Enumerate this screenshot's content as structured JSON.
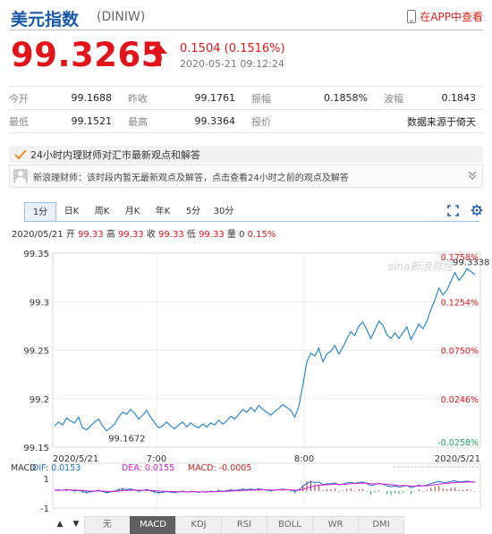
{
  "header": {
    "title": "美元指数",
    "code": "(DINIW)",
    "app_link": "在APP中查看"
  },
  "quote": {
    "price": "99.3265",
    "change": "0.1504 (0.1516%)",
    "timestamp": "2020-05-21 09:12:24"
  },
  "stats": {
    "rows": [
      [
        {
          "label": "今开",
          "value": "99.1688"
        },
        {
          "label": "昨收",
          "value": "99.1761"
        },
        {
          "label": "振幅",
          "value": "0.1858%"
        },
        {
          "label": "波幅",
          "value": "0.1843"
        }
      ],
      [
        {
          "label": "最低",
          "value": "99.1521"
        },
        {
          "label": "最高",
          "value": "99.3364"
        },
        {
          "label": "报价",
          "value": ""
        },
        {
          "label": "",
          "value": "数据来源于倚天"
        }
      ]
    ]
  },
  "notice": {
    "title": "24小时内理财师对汇市最新观点和解答",
    "advisor_text": "新浪理财师：该时段内暂无最新观点及解答，点击查看24小时之前的观点及解答"
  },
  "chart_tabs": [
    "1分",
    "日K",
    "周K",
    "月K",
    "年K",
    "5分",
    "30分"
  ],
  "chart_tabs_active": 0,
  "ohlc_line": {
    "date": "2020/05/21",
    "open_label": "开",
    "open": "99.33",
    "high_label": "高",
    "high": "99.33",
    "close_label": "收",
    "close": "99.33",
    "low_label": "低",
    "low": "99.33",
    "vol_label": "量",
    "vol": "0",
    "pct": "0.15%"
  },
  "chart_data": [
    {
      "type": "line",
      "x_ticks": [
        "2020/5/21",
        "7:00",
        "8:00",
        "2020/5/21"
      ],
      "y_ticks": [
        "99.35",
        "99.3",
        "99.25",
        "99.2",
        "99.15"
      ],
      "y_right_ticks": [
        "0.1758%",
        "0.1254%",
        "0.0750%",
        "0.0246%",
        "-0.0258%"
      ],
      "ylim": [
        99.15,
        99.35
      ],
      "annotations": {
        "low": "99.1672",
        "high": "99.3338"
      },
      "watermark": "sina新浪财经",
      "series": [
        {
          "values": [
            99.172,
            99.176,
            99.173,
            99.18,
            99.177,
            99.175,
            99.181,
            99.17,
            99.168,
            99.172,
            99.176,
            99.179,
            99.172,
            99.167,
            99.17,
            99.174,
            99.181,
            99.186,
            99.184,
            99.189,
            99.185,
            99.179,
            99.183,
            99.188,
            99.181,
            99.175,
            99.17,
            99.172,
            99.176,
            99.172,
            99.169,
            99.173,
            99.176,
            99.171,
            99.175,
            99.172,
            99.17,
            99.174,
            99.171,
            99.175,
            99.173,
            99.178,
            99.174,
            99.177,
            99.182,
            99.179,
            99.184,
            99.189,
            99.186,
            99.191,
            99.187,
            99.193,
            99.189,
            99.186,
            99.183,
            99.187,
            99.19,
            99.194,
            99.191,
            99.188,
            99.181,
            99.192,
            99.214,
            99.238,
            99.247,
            99.244,
            99.252,
            99.238,
            99.246,
            99.249,
            99.255,
            99.246,
            99.253,
            99.262,
            99.269,
            99.265,
            99.275,
            99.279,
            99.271,
            99.262,
            99.271,
            99.28,
            99.276,
            99.266,
            99.262,
            99.268,
            99.262,
            99.268,
            99.274,
            99.261,
            99.269,
            99.277,
            99.272,
            99.28,
            99.292,
            99.302,
            99.314,
            99.307,
            99.312,
            99.321,
            99.33,
            99.322,
            99.327,
            99.334,
            99.331,
            99.328
          ]
        }
      ]
    },
    {
      "type": "bar",
      "title": "MACD",
      "legend": [
        {
          "name": "DIF: 0.0153",
          "color": "#1a6fc7"
        },
        {
          "name": "DEA: 0.0155",
          "color": "#d21bd2"
        },
        {
          "name": "MACD: -0.0005",
          "color": "#d4211c"
        }
      ],
      "y_ticks": [
        "1",
        "-1"
      ],
      "ylim": [
        -1.2,
        1.2
      ],
      "dif": [
        0.05,
        0.08,
        0.05,
        0.1,
        0.06,
        0.02,
        0.05,
        -0.03,
        -0.08,
        -0.05,
        0.0,
        0.05,
        -0.03,
        -0.1,
        -0.05,
        0.0,
        0.08,
        0.14,
        0.1,
        0.14,
        0.08,
        0.0,
        0.05,
        0.1,
        0.03,
        -0.05,
        -0.1,
        -0.08,
        -0.03,
        -0.07,
        -0.1,
        -0.06,
        -0.02,
        -0.07,
        -0.03,
        -0.05,
        -0.08,
        -0.04,
        -0.07,
        -0.02,
        -0.04,
        0.02,
        -0.02,
        0.02,
        0.07,
        0.04,
        0.08,
        0.12,
        0.09,
        0.13,
        0.09,
        0.14,
        0.1,
        0.06,
        0.03,
        0.06,
        0.09,
        0.12,
        0.09,
        0.06,
        -0.02,
        0.08,
        0.3,
        0.5,
        0.6,
        0.55,
        0.58,
        0.42,
        0.46,
        0.48,
        0.52,
        0.4,
        0.45,
        0.52,
        0.56,
        0.5,
        0.56,
        0.58,
        0.48,
        0.36,
        0.42,
        0.5,
        0.45,
        0.34,
        0.28,
        0.32,
        0.26,
        0.3,
        0.36,
        0.22,
        0.3,
        0.38,
        0.32,
        0.38,
        0.48,
        0.55,
        0.62,
        0.55,
        0.56,
        0.62,
        0.66,
        0.58,
        0.6,
        0.64,
        0.6,
        0.56
      ],
      "dea": [
        0.05,
        0.06,
        0.06,
        0.07,
        0.07,
        0.06,
        0.06,
        0.04,
        0.02,
        0.0,
        0.0,
        0.01,
        0.0,
        -0.02,
        -0.03,
        -0.02,
        0.0,
        0.03,
        0.04,
        0.06,
        0.07,
        0.05,
        0.05,
        0.06,
        0.05,
        0.03,
        0.0,
        -0.02,
        -0.02,
        -0.03,
        -0.04,
        -0.04,
        -0.04,
        -0.05,
        -0.04,
        -0.04,
        -0.05,
        -0.05,
        -0.05,
        -0.04,
        -0.04,
        -0.03,
        -0.03,
        -0.02,
        0.0,
        0.01,
        0.02,
        0.04,
        0.05,
        0.07,
        0.07,
        0.08,
        0.09,
        0.08,
        0.07,
        0.07,
        0.08,
        0.09,
        0.09,
        0.08,
        0.06,
        0.06,
        0.11,
        0.19,
        0.27,
        0.33,
        0.38,
        0.39,
        0.4,
        0.42,
        0.44,
        0.43,
        0.43,
        0.45,
        0.47,
        0.48,
        0.5,
        0.51,
        0.5,
        0.47,
        0.46,
        0.47,
        0.46,
        0.44,
        0.41,
        0.39,
        0.36,
        0.35,
        0.35,
        0.32,
        0.32,
        0.33,
        0.33,
        0.34,
        0.37,
        0.41,
        0.45,
        0.47,
        0.49,
        0.52,
        0.55,
        0.55,
        0.56,
        0.58,
        0.58,
        0.58
      ]
    }
  ],
  "bottom_tabs": [
    "无",
    "MACD",
    "KDJ",
    "RSI",
    "BOLL",
    "WR",
    "DMI"
  ],
  "bottom_tabs_active": 1,
  "scroll_up": "▲",
  "scroll_down": "▼",
  "colors": {
    "brand_blue": "#1a5aa5",
    "up_red": "#e0141a",
    "line_blue": "#2b86c8",
    "macd_down_green": "#1aa35c"
  }
}
